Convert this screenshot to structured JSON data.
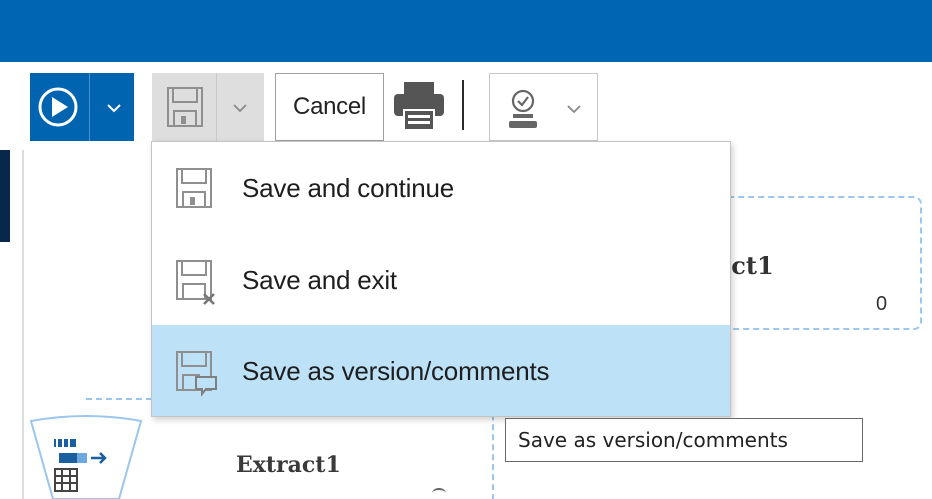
{
  "toolbar": {
    "run_icon": "play-circle-icon",
    "save_icon": "floppy-disk-icon",
    "cancel_label": "Cancel",
    "print_icon": "printer-icon",
    "approve_icon": "approval-stamp-icon"
  },
  "save_menu": {
    "items": [
      {
        "label": "Save and continue",
        "icon": "floppy-disk-icon"
      },
      {
        "label": "Save and exit",
        "icon": "floppy-disk-close-icon"
      },
      {
        "label": "Save as version/comments",
        "icon": "floppy-disk-comment-icon",
        "highlighted": true
      }
    ]
  },
  "tooltip": {
    "text": "Save as version/comments"
  },
  "canvas": {
    "nodes": [
      {
        "title_visible": "ect1",
        "count": "0"
      },
      {
        "title": "Extract1",
        "icon": "extract-table-icon"
      }
    ]
  },
  "colors": {
    "titlebar": "#0065b3",
    "run_button": "#0064b1",
    "menu_highlight": "#bde2f8",
    "node_border": "#9bc6ee"
  }
}
